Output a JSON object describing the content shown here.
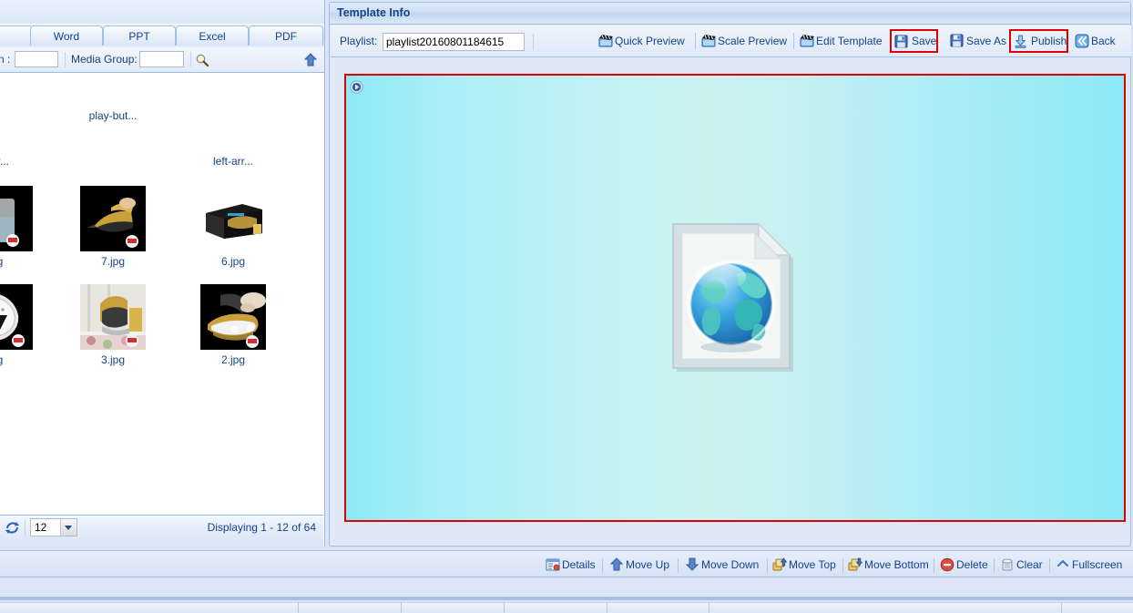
{
  "left_panel": {
    "tabs": [
      {
        "label": "",
        "name": "tab-partial-left"
      },
      {
        "label": "Word",
        "name": "tab-word"
      },
      {
        "label": "PPT",
        "name": "tab-ppt"
      },
      {
        "label": "Excel",
        "name": "tab-excel"
      },
      {
        "label": "PDF",
        "name": "tab-pdf"
      }
    ],
    "search": {
      "name_label": "n :",
      "name_value": "",
      "media_group_label": "Media Group:",
      "media_group_value": "",
      "search_icon": "magnifier-icon",
      "collapse_icon": "up-arrow-icon"
    },
    "thumbnails": [
      {
        "caption": "play-but...",
        "kind": "blank"
      },
      {
        "caption": "ar...",
        "kind": "blank"
      },
      {
        "caption": "left-arr...",
        "kind": "blank"
      },
      {
        "caption": "g",
        "kind": "photo-jug"
      },
      {
        "caption": "7.jpg",
        "kind": "photo-iron-steam"
      },
      {
        "caption": "6.jpg",
        "kind": "photo-box"
      },
      {
        "caption": "g",
        "kind": "photo-soleplate"
      },
      {
        "caption": "3.jpg",
        "kind": "photo-iron-board"
      },
      {
        "caption": "2.jpg",
        "kind": "photo-iron-hand"
      }
    ],
    "statusbar": {
      "refresh_icon": "refresh-icon",
      "page_size": "12",
      "displaying": "Displaying 1 - 12 of 64"
    }
  },
  "main": {
    "header_title": "Template Info",
    "playlist_label": "Playlist:",
    "playlist_value": "playlist20160801184615",
    "toolbar": [
      {
        "label": "Quick Preview",
        "name": "quick-preview-button",
        "icon": "clapperboard-icon",
        "highlighted": false
      },
      {
        "label": "Scale Preview",
        "name": "scale-preview-button",
        "icon": "clapperboard-icon",
        "highlighted": false
      },
      {
        "label": "Edit Template",
        "name": "edit-template-button",
        "icon": "clapperboard-icon",
        "highlighted": false
      },
      {
        "label": "Save",
        "name": "save-button",
        "icon": "floppy-icon",
        "highlighted": true
      },
      {
        "label": "Save As",
        "name": "save-as-button",
        "icon": "floppy-icon",
        "highlighted": false
      },
      {
        "label": "Publish",
        "name": "publish-button",
        "icon": "download-icon",
        "highlighted": true
      },
      {
        "label": "Back",
        "name": "back-button",
        "icon": "back-chevrons-icon",
        "highlighted": false
      }
    ],
    "canvas": {
      "play_icon": "play-circle-icon",
      "content_icon": "html-document-globe-icon",
      "border_color": "#e00000",
      "bg_from": "#8ce9f6",
      "bg_to": "#cdf2f2"
    }
  },
  "bottom_toolbar": [
    {
      "label": "Details",
      "name": "details-button",
      "icon": "details-icon"
    },
    {
      "label": "Move Up",
      "name": "move-up-button",
      "icon": "up-arrow-icon"
    },
    {
      "label": "Move Down",
      "name": "move-down-button",
      "icon": "down-arrow-icon"
    },
    {
      "label": "Move Top",
      "name": "move-top-button",
      "icon": "move-top-icon"
    },
    {
      "label": "Move Bottom",
      "name": "move-bottom-button",
      "icon": "move-bottom-icon"
    },
    {
      "label": "Delete",
      "name": "delete-button",
      "icon": "delete-circle-icon"
    },
    {
      "label": "Clear",
      "name": "clear-button",
      "icon": "trash-icon"
    },
    {
      "label": "Fullscreen",
      "name": "fullscreen-button",
      "icon": "chevron-up-icon"
    }
  ],
  "colors": {
    "accent": "#15428b",
    "highlight": "#e00000",
    "panel_bg": "#dbe5f5"
  }
}
